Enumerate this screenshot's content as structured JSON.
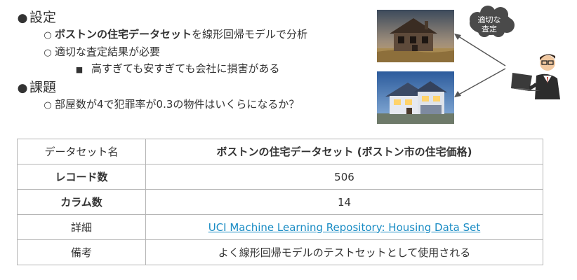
{
  "outline": {
    "setting": {
      "title": "設定",
      "item1": {
        "bold": "ボストンの住宅データセット",
        "rest": "を線形回帰モデルで分析"
      },
      "item2": "適切な査定結果が必要",
      "item2_sub": "高すぎても安すぎても会社に損害がある"
    },
    "issue": {
      "title": "課題",
      "item1": "部屋数が4で犯罪率が0.3の物件はいくらになるか？"
    }
  },
  "illustration": {
    "thought_bubble_line1": "適切な",
    "thought_bubble_line2": "査定",
    "icons": [
      "old-house-photo",
      "new-house-photo",
      "person-at-laptop-icon",
      "thought-cloud-icon"
    ]
  },
  "table": {
    "rows": [
      {
        "key": "データセット名",
        "value": "ボストンの住宅データセット (ボストン市の住宅価格)"
      },
      {
        "key": "レコード数",
        "value": "506"
      },
      {
        "key": "カラム数",
        "value": "14"
      },
      {
        "key": "詳細",
        "value": "UCI Machine Learning Repository: Housing Data Set"
      },
      {
        "key": "備考",
        "value": "よく線形回帰モデルのテストセットとして使用される"
      }
    ]
  },
  "colors": {
    "link": "#1a8cc4",
    "border": "#b5b5b5",
    "cloud": "#4a4a4a"
  }
}
